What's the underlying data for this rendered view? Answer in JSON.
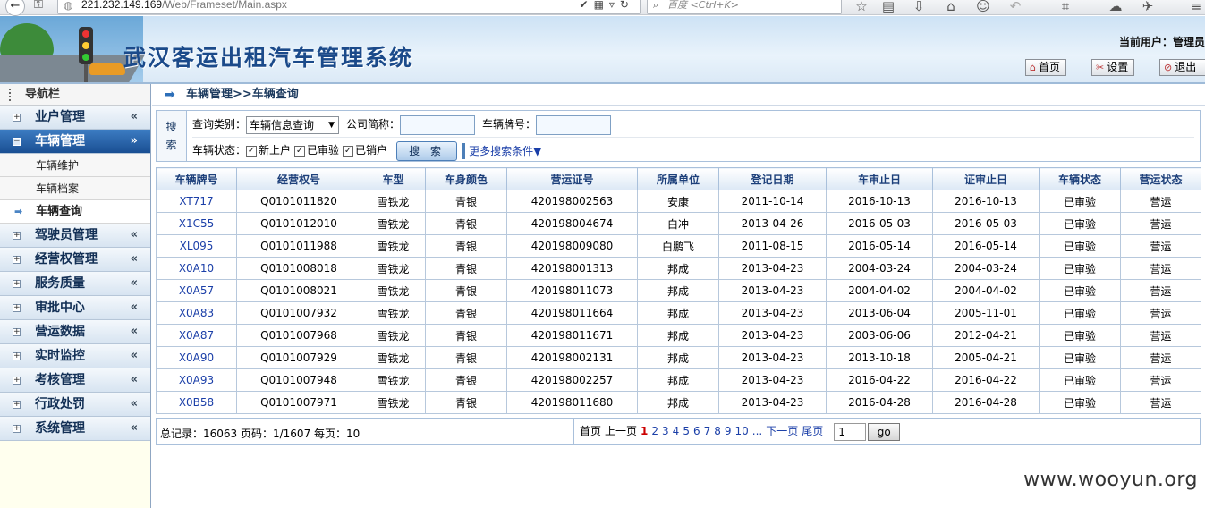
{
  "browser": {
    "url_host": "221.232.149.169",
    "url_path": "/Web/Frameset/Main.aspx",
    "search_placeholder": "百度 <Ctrl+K>"
  },
  "banner": {
    "title": "武汉客运出租汽车管理系统",
    "current_user_label": "当前用户：管理员",
    "home_button": "首页",
    "settings_button": "设置",
    "logout_button": "退出"
  },
  "sidebar": {
    "header": "导航栏",
    "menus": [
      {
        "label": "业户管理",
        "active": false
      },
      {
        "label": "车辆管理",
        "active": true
      },
      {
        "label": "驾驶员管理",
        "active": false
      },
      {
        "label": "经营权管理",
        "active": false
      },
      {
        "label": "服务质量",
        "active": false
      },
      {
        "label": "审批中心",
        "active": false
      },
      {
        "label": "营运数据",
        "active": false
      },
      {
        "label": "实时监控",
        "active": false
      },
      {
        "label": "考核管理",
        "active": false
      },
      {
        "label": "行政处罚",
        "active": false
      },
      {
        "label": "系统管理",
        "active": false
      }
    ],
    "sub_items": [
      "车辆维护",
      "车辆档案",
      "车辆查询"
    ]
  },
  "breadcrumb": "车辆管理>>车辆查询",
  "search": {
    "side_label_1": "搜",
    "side_label_2": "索",
    "query_type_label": "查询类别：",
    "query_type_value": "车辆信息查询",
    "company_label": "公司简称：",
    "plate_label": "车辆牌号：",
    "status_label": "车辆状态：",
    "status_options": [
      "新上户",
      "已审验",
      "已销户"
    ],
    "search_button": "搜 索",
    "more_conditions": "更多搜索条件▼"
  },
  "table": {
    "headers": [
      "车辆牌号",
      "经营权号",
      "车型",
      "车身颜色",
      "营运证号",
      "所属单位",
      "登记日期",
      "车审止日",
      "证审止日",
      "车辆状态",
      "营运状态"
    ],
    "rows": [
      [
        "XT717",
        "Q0101011820",
        "雪铁龙",
        "青银",
        "420198002563",
        "安康",
        "2011-10-14",
        "2016-10-13",
        "2016-10-13",
        "已审验",
        "营运"
      ],
      [
        "X1C55",
        "Q0101012010",
        "雪铁龙",
        "青银",
        "420198004674",
        "白冲",
        "2013-04-26",
        "2016-05-03",
        "2016-05-03",
        "已审验",
        "营运"
      ],
      [
        "XL095",
        "Q0101011988",
        "雪铁龙",
        "青银",
        "420198009080",
        "白鹏飞",
        "2011-08-15",
        "2016-05-14",
        "2016-05-14",
        "已审验",
        "营运"
      ],
      [
        "X0A10",
        "Q0101008018",
        "雪铁龙",
        "青银",
        "420198001313",
        "邦成",
        "2013-04-23",
        "2004-03-24",
        "2004-03-24",
        "已审验",
        "营运"
      ],
      [
        "X0A57",
        "Q0101008021",
        "雪铁龙",
        "青银",
        "420198011073",
        "邦成",
        "2013-04-23",
        "2004-04-02",
        "2004-04-02",
        "已审验",
        "营运"
      ],
      [
        "X0A83",
        "Q0101007932",
        "雪铁龙",
        "青银",
        "420198011664",
        "邦成",
        "2013-04-23",
        "2013-06-04",
        "2005-11-01",
        "已审验",
        "营运"
      ],
      [
        "X0A87",
        "Q0101007968",
        "雪铁龙",
        "青银",
        "420198011671",
        "邦成",
        "2013-04-23",
        "2003-06-06",
        "2012-04-21",
        "已审验",
        "营运"
      ],
      [
        "X0A90",
        "Q0101007929",
        "雪铁龙",
        "青银",
        "420198002131",
        "邦成",
        "2013-04-23",
        "2013-10-18",
        "2005-04-21",
        "已审验",
        "营运"
      ],
      [
        "X0A93",
        "Q0101007948",
        "雪铁龙",
        "青银",
        "420198002257",
        "邦成",
        "2013-04-23",
        "2016-04-22",
        "2016-04-22",
        "已审验",
        "营运"
      ],
      [
        "X0B58",
        "Q0101007971",
        "雪铁龙",
        "青银",
        "420198011680",
        "邦成",
        "2013-04-23",
        "2016-04-28",
        "2016-04-28",
        "已审验",
        "营运"
      ]
    ]
  },
  "pager": {
    "summary": "总记录：16063 页码：1/1607 每页：10",
    "first": "首页",
    "prev": "上一页",
    "current_page": "1",
    "pages": [
      "2",
      "3",
      "4",
      "5",
      "6",
      "7",
      "8",
      "9",
      "10"
    ],
    "ellipsis": "...",
    "next": "下一页",
    "last": "尾页",
    "input_value": "1",
    "go_button": "go"
  },
  "watermark": "www.wooyun.org"
}
